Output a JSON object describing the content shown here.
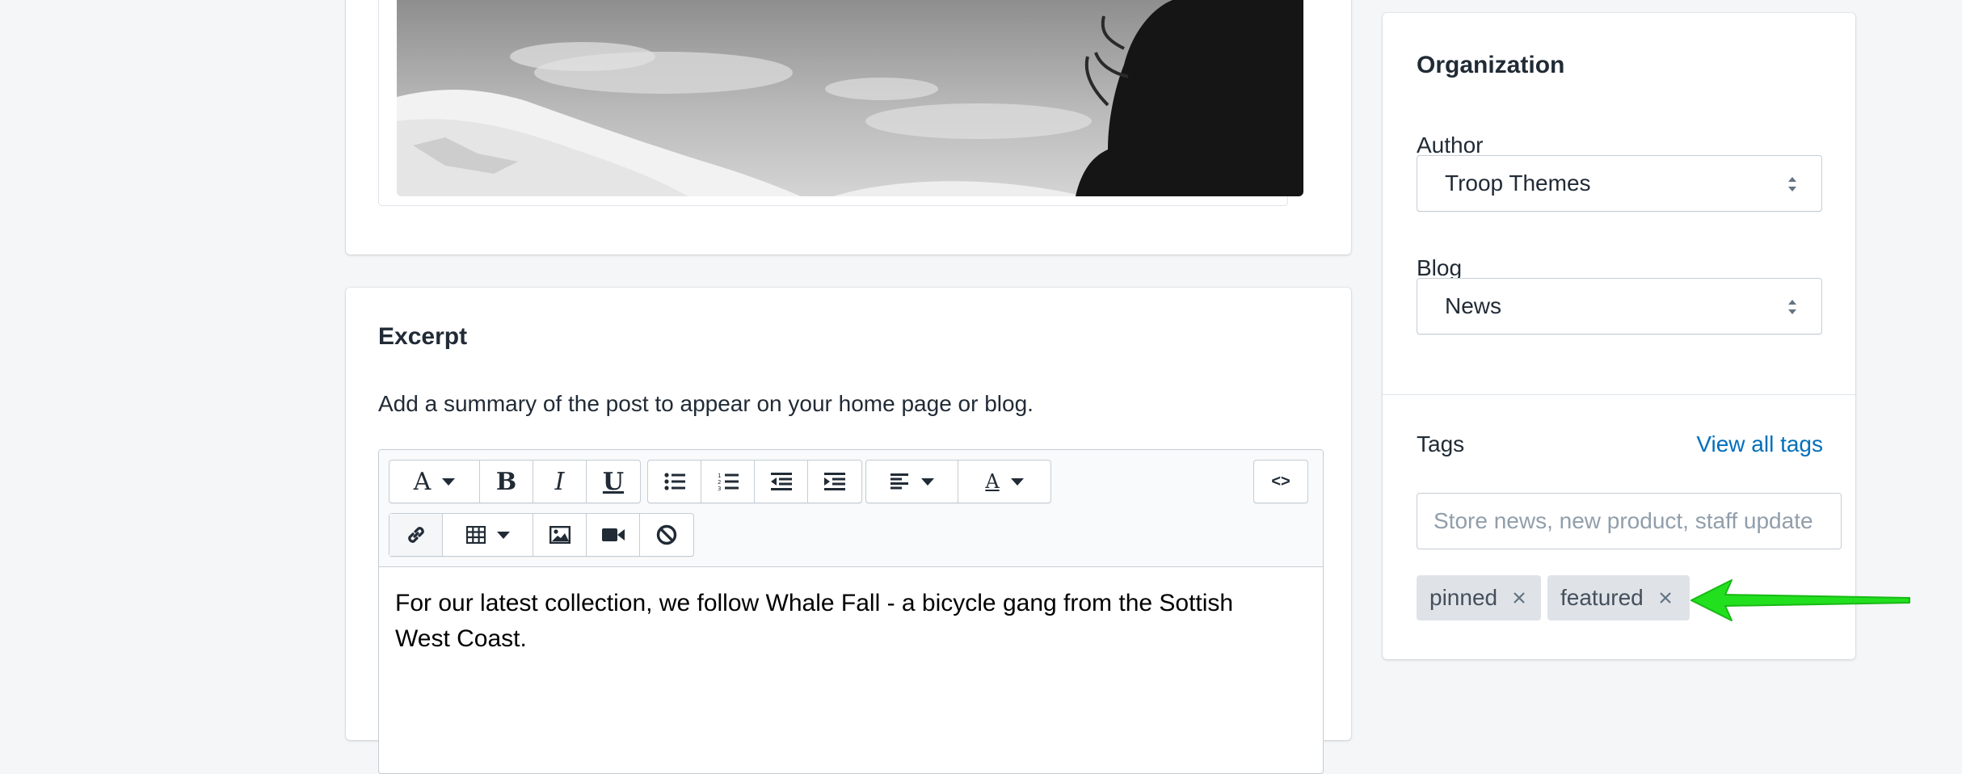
{
  "excerpt": {
    "title": "Excerpt",
    "help_text": "Add a summary of the post to appear on your home page or blog.",
    "body": "For our latest collection, we follow Whale Fall - a bicycle gang from the Sottish West Coast.",
    "toolbar": {
      "html_toggle_label": "<>",
      "icons": [
        "font-icon",
        "bold-icon",
        "italic-icon",
        "underline-icon",
        "bullet-list-icon",
        "numbered-list-icon",
        "outdent-icon",
        "indent-icon",
        "align-left-icon",
        "text-color-icon",
        "link-icon",
        "table-icon",
        "image-icon",
        "video-icon",
        "clear-format-icon"
      ]
    }
  },
  "organization": {
    "title": "Organization",
    "author_label": "Author",
    "author_value": "Troop Themes",
    "blog_label": "Blog",
    "blog_value": "News",
    "tags_label": "Tags",
    "view_all_tags": "View all tags",
    "tags_placeholder": "Store news, new product, staff update",
    "tags": [
      {
        "label": "pinned"
      },
      {
        "label": "featured"
      }
    ]
  },
  "colors": {
    "background": "#f4f6f8",
    "link": "#006fbb",
    "tag_bg": "#dfe3e8",
    "annotation_arrow": "#22e01e"
  }
}
